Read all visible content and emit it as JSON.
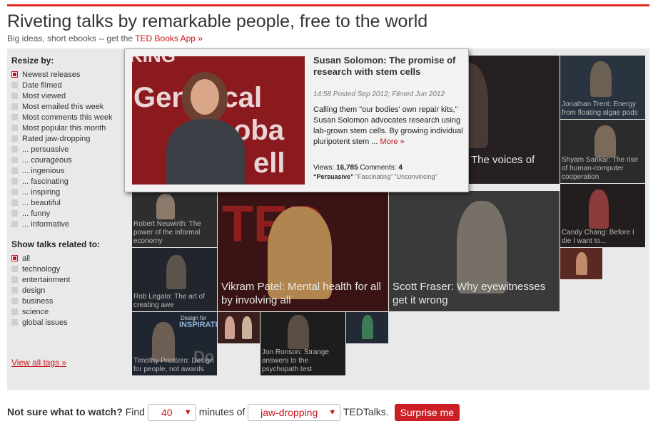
{
  "header": {
    "title": "Riveting talks by remarkable people, free to the world",
    "subtitle_prefix": "Big ideas, short ebooks -- get the ",
    "subtitle_link": "TED Books App »"
  },
  "sidebar": {
    "resize_heading": "Resize by:",
    "resize_options": [
      {
        "label": "Newest releases",
        "selected": true
      },
      {
        "label": "Date filmed",
        "selected": false
      },
      {
        "label": "Most viewed",
        "selected": false
      },
      {
        "label": "Most emailed this week",
        "selected": false
      },
      {
        "label": "Most comments this week",
        "selected": false
      },
      {
        "label": "Most popular this month",
        "selected": false
      },
      {
        "label": "Rated jaw-dropping",
        "selected": false
      },
      {
        "label": "... persuasive",
        "selected": false
      },
      {
        "label": "... courageous",
        "selected": false
      },
      {
        "label": "... ingenious",
        "selected": false
      },
      {
        "label": "... fascinating",
        "selected": false
      },
      {
        "label": "... inspiring",
        "selected": false
      },
      {
        "label": "... beautiful",
        "selected": false
      },
      {
        "label": "... funny",
        "selected": false
      },
      {
        "label": "... informative",
        "selected": false
      }
    ],
    "related_heading": "Show talks related to:",
    "related_options": [
      {
        "label": "all",
        "selected": true
      },
      {
        "label": "technology",
        "selected": false
      },
      {
        "label": "entertainment",
        "selected": false
      },
      {
        "label": "design",
        "selected": false
      },
      {
        "label": "business",
        "selected": false
      },
      {
        "label": "science",
        "selected": false
      },
      {
        "label": "global issues",
        "selected": false
      }
    ],
    "view_all": "View all tags »"
  },
  "tiles": [
    {
      "caption": "The voices of"
    },
    {
      "caption": "Jonathan Trent: Energy from floating algae pods"
    },
    {
      "caption": "Shyam Sankar: The rise of human-computer cooperation"
    },
    {
      "caption": "Candy Chang: Before I die I want to..."
    },
    {
      "caption": ""
    },
    {
      "caption": "Robert Neuwirth: The power of the informal economy"
    },
    {
      "caption": "Rob Legato: The art of creating awe"
    },
    {
      "caption": "Vikram Patel: Mental health for all by involving all"
    },
    {
      "caption": "Scott Fraser: Why eyewitnesses get it wrong"
    },
    {
      "caption": "Timothy Prestero: Design for people, not awards"
    },
    {
      "caption": ""
    },
    {
      "caption": "Jon Ronson: Strange answers to the psychopath test"
    },
    {
      "caption": ""
    }
  ],
  "tile_text": {
    "ted": "TED",
    "inspiration": "INSPIRATIO",
    "design_for": "Design for",
    "d": "Do"
  },
  "popup": {
    "title": "Susan Solomon: The promise of research with stem cells",
    "meta": "14:58 Posted Sep 2012; Filmed Jun 2012",
    "description": "Calling them \"our bodies' own repair kits,\" Susan Solomon advocates research using lab-grown stem cells. By growing individual pluripotent stem ... ",
    "more": "More »",
    "views_label": "Views: ",
    "views": "16,785",
    "comments_label": " Comments: ",
    "comments": "4",
    "tag_main": "“Persuasive”",
    "tag_others": " “Fascinating” “Unconvincing”",
    "image_words": [
      "Genetical",
      "oba",
      "ell",
      "KING"
    ]
  },
  "finder": {
    "question": "Not sure what to watch?",
    "find": "Find",
    "minutes_value": "40",
    "minutes_of": "minutes of",
    "mood_value": "jaw-dropping",
    "tedtalks": "TEDTalks.",
    "surprise_button": "Surprise me"
  },
  "colors": {
    "accent": "#c8141c",
    "panel": "#e9e9e9",
    "tile_bg": "#1c1c1c"
  }
}
